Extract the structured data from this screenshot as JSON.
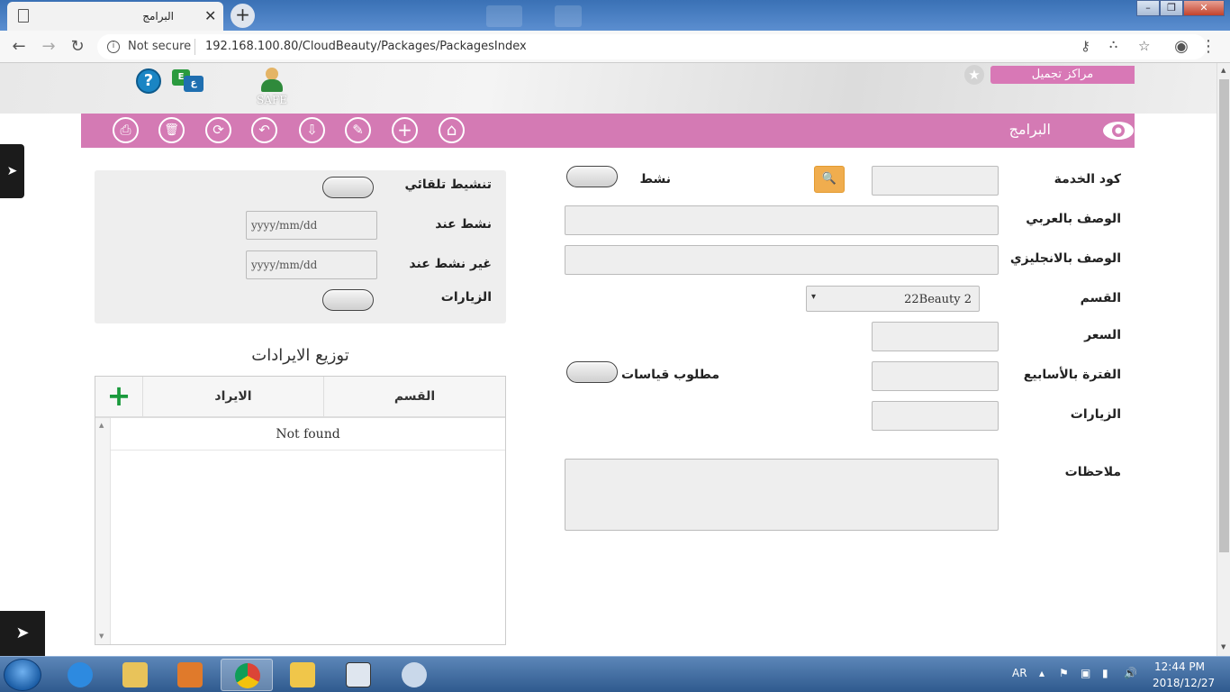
{
  "browser": {
    "tab_title": "البرامج",
    "tab_close": "✕",
    "new_tab": "+",
    "security": "Not secure",
    "url": "192.168.100.80/CloudBeauty/Packages/PackagesIndex",
    "window_buttons": {
      "minimize": "–",
      "maximize": "❐",
      "close": "✕"
    }
  },
  "header": {
    "help_symbol": "?",
    "lang_badge_a": "E",
    "lang_badge_b": "ع",
    "safe_label": "SAFE",
    "center_name": "مراكز تجميل",
    "star": "★"
  },
  "toolbar": {
    "title": "البرامج",
    "icons": [
      "print-icon",
      "trash-icon",
      "refresh-icon",
      "undo-icon",
      "save-icon",
      "edit-icon",
      "add-icon",
      "home-icon"
    ],
    "glyphs": {
      "print": "⎙",
      "trash": "🗑",
      "refresh": "⟳",
      "undo": "↶",
      "save": "⇩",
      "edit": "✎",
      "add": "+",
      "home": "⌂"
    }
  },
  "form": {
    "service_code_label": "كود الخدمة",
    "active_label": "نشط",
    "desc_ar_label": "الوصف بالعربي",
    "desc_en_label": "الوصف بالانجليزي",
    "department_label": "القسم",
    "department_value": "22Beauty 2",
    "department_arrow": "▾",
    "price_label": "السعر",
    "weeks_label": "الفترة بالأسابيع",
    "measurements_label": "مطلوب قياسات",
    "visits_label": "الزيارات",
    "notes_label": "ملاحظات",
    "search_glyph": "🔍"
  },
  "side_panel": {
    "auto_activate_label": "تنشيط تلقائي",
    "active_on_label": "نشط عند",
    "active_on_placeholder": "yyyy/mm/dd",
    "inactive_on_label": "غير نشط عند",
    "inactive_on_placeholder": "yyyy/mm/dd",
    "visits_label": "الزيارات"
  },
  "distribution": {
    "title": "توزيع الايرادات",
    "columns": [
      "القسم",
      "الايراد"
    ],
    "add_symbol": "+",
    "empty_text": "Not found",
    "scroll_up": "▲",
    "scroll_down": "▼"
  },
  "side_tabs": {
    "arrow": "➤"
  },
  "taskbar": {
    "lang": "AR",
    "time": "12:44 PM",
    "date": "2018/12/27"
  },
  "colors": {
    "brand_pink": "#d47ab4",
    "search_orange": "#f0ad4e",
    "add_green": "#1a9a3c"
  }
}
